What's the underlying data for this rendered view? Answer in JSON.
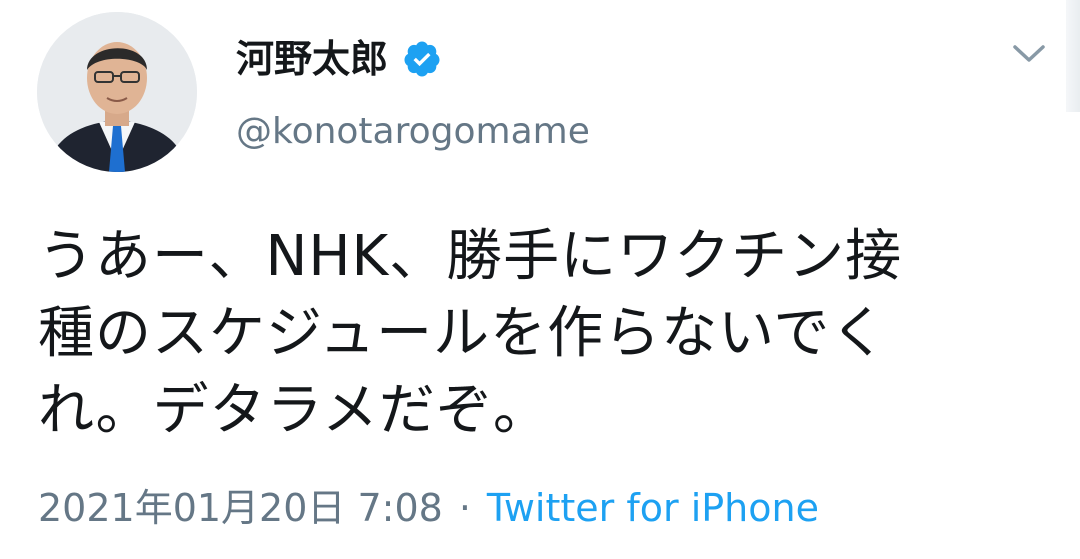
{
  "user": {
    "display_name": "河野太郎",
    "handle": "@konotarogomame",
    "verified": true
  },
  "tweet": {
    "text": "うあー、NHK、勝手にワクチン接\n種のスケジュールを作らないでく\nれ。デタラメだぞ。",
    "timestamp": "2021年01月20日 7:08",
    "separator": "·",
    "source": "Twitter for iPhone"
  },
  "icons": {
    "verified": "verified-badge-icon",
    "menu": "chevron-down-icon"
  },
  "colors": {
    "text": "#14171a",
    "secondary": "#657786",
    "link": "#1da1f2",
    "verified": "#1da1f2"
  }
}
